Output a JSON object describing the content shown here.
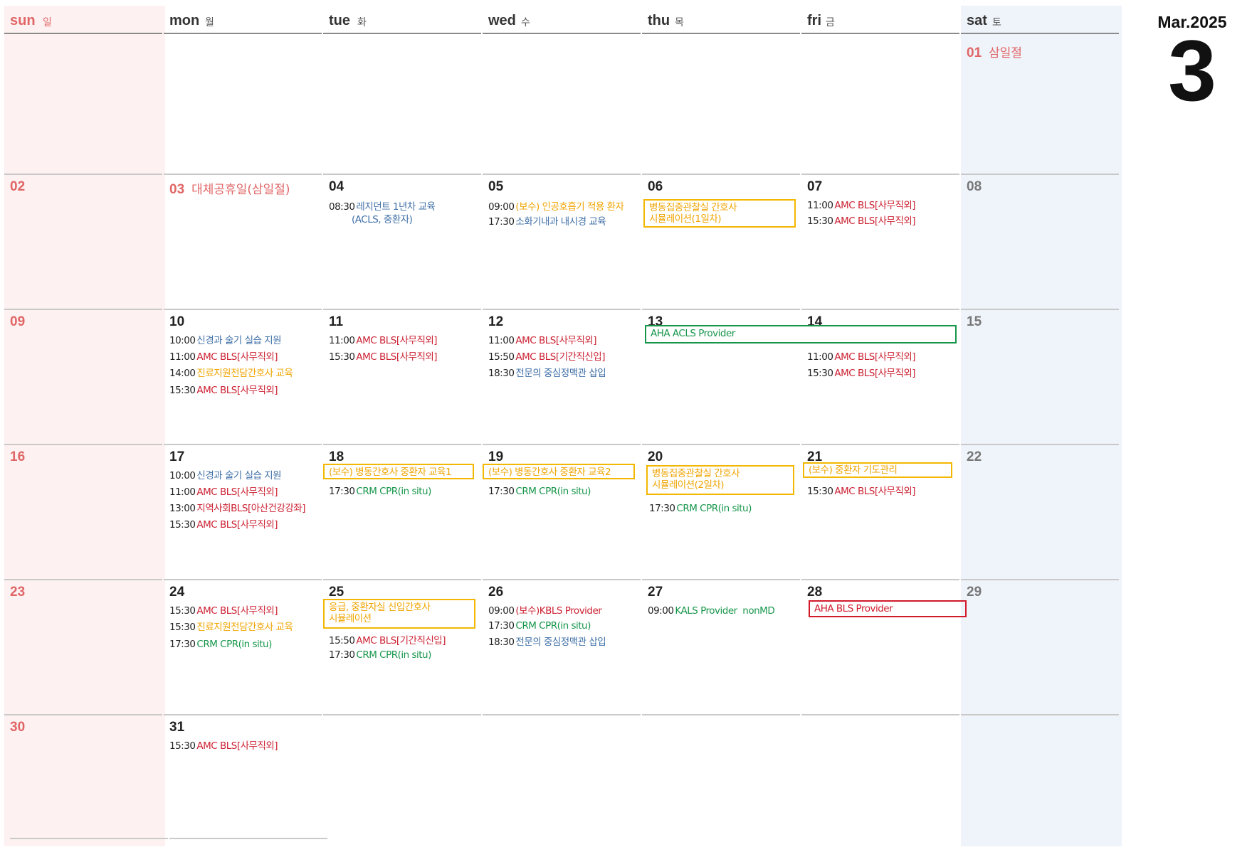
{
  "header": {
    "month_year": "Mar.2025",
    "month_number": "3"
  },
  "weekdays": [
    {
      "en": "sun",
      "ko": "일"
    },
    {
      "en": "mon",
      "ko": "월"
    },
    {
      "en": "tue",
      "ko": "화"
    },
    {
      "en": "wed",
      "ko": "수"
    },
    {
      "en": "thu",
      "ko": "목"
    },
    {
      "en": "fri",
      "ko": "금"
    },
    {
      "en": "sat",
      "ko": "토"
    }
  ],
  "days": {
    "d01": {
      "num": "01",
      "holiday": "삼일절"
    },
    "d02": {
      "num": "02"
    },
    "d03": {
      "num": "03",
      "holiday": "대체공휴일(삼일절)"
    },
    "d04": {
      "num": "04",
      "events": [
        {
          "time": "08:30",
          "title": "레지던트 1년차 교육",
          "title2": "(ACLS, 중환자)"
        }
      ]
    },
    "d05": {
      "num": "05",
      "events": [
        {
          "time": "09:00",
          "title": "(보수) 인공호흡기 적용 환자"
        },
        {
          "time": "17:30",
          "title": "소화기내과 내시경 교육"
        }
      ]
    },
    "d06": {
      "num": "06",
      "box": {
        "line1": "병동집중관찰실 간호사",
        "line2": "시뮬레이션(1일차)"
      }
    },
    "d07": {
      "num": "07",
      "events": [
        {
          "time": "11:00",
          "title": "AMC BLS[사무직외]"
        },
        {
          "time": "15:30",
          "title": "AMC BLS[사무직외]"
        }
      ]
    },
    "d08": {
      "num": "08"
    },
    "d09": {
      "num": "09"
    },
    "d10": {
      "num": "10",
      "events": [
        {
          "time": "10:00",
          "title": "신경과 술기 실습 지원"
        },
        {
          "time": "11:00",
          "title": "AMC BLS[사무직외]"
        },
        {
          "time": "14:00",
          "title": "진료지원전담간호사 교육"
        },
        {
          "time": "15:30",
          "title": "AMC BLS[사무직외]"
        }
      ]
    },
    "d11": {
      "num": "11",
      "events": [
        {
          "time": "11:00",
          "title": "AMC BLS[사무직외]"
        },
        {
          "time": "15:30",
          "title": "AMC BLS[사무직외]"
        }
      ]
    },
    "d12": {
      "num": "12",
      "events": [
        {
          "time": "11:00",
          "title": "AMC BLS[사무직외]"
        },
        {
          "time": "15:50",
          "title": "AMC BLS[기간직신입]"
        },
        {
          "time": "18:30",
          "title": "전문의 중심정맥관 삽입"
        }
      ]
    },
    "d13": {
      "num": "13",
      "span_box": "AHA ACLS Provider"
    },
    "d14": {
      "num": "14",
      "events": [
        {
          "time": "11:00",
          "title": "AMC BLS[사무직외]"
        },
        {
          "time": "15:30",
          "title": "AMC BLS[사무직외]"
        }
      ]
    },
    "d15": {
      "num": "15"
    },
    "d16": {
      "num": "16"
    },
    "d17": {
      "num": "17",
      "events": [
        {
          "time": "10:00",
          "title": "신경과 술기 실습 지원"
        },
        {
          "time": "11:00",
          "title": "AMC BLS[사무직외]"
        },
        {
          "time": "13:00",
          "title": "지역사회BLS[아산건강강좌]"
        },
        {
          "time": "15:30",
          "title": "AMC BLS[사무직외]"
        }
      ]
    },
    "d18": {
      "num": "18",
      "box": {
        "line1": "(보수) 병동간호사 중환자 교육1"
      },
      "events": [
        {
          "time": "17:30",
          "title": "CRM CPR(in situ)"
        }
      ]
    },
    "d19": {
      "num": "19",
      "box": {
        "line1": "(보수) 병동간호사 중환자 교육2"
      },
      "events": [
        {
          "time": "17:30",
          "title": "CRM CPR(in situ)"
        }
      ]
    },
    "d20": {
      "num": "20",
      "box": {
        "line1": "병동집중관찰실 간호사",
        "line2": "시뮬레이션(2일차)"
      },
      "events": [
        {
          "time": "17:30",
          "title": "CRM CPR(in situ)"
        }
      ]
    },
    "d21": {
      "num": "21",
      "box": {
        "line1": "(보수) 중환자 기도관리"
      },
      "events": [
        {
          "time": "15:30",
          "title": "AMC BLS[사무직외]"
        }
      ]
    },
    "d22": {
      "num": "22"
    },
    "d23": {
      "num": "23"
    },
    "d24": {
      "num": "24",
      "events": [
        {
          "time": "15:30",
          "title": "AMC BLS[사무직외]"
        },
        {
          "time": "15:30",
          "title": "진료지원전담간호사 교육"
        },
        {
          "time": "17:30",
          "title": "CRM CPR(in situ)"
        }
      ]
    },
    "d25": {
      "num": "25",
      "box": {
        "line1": "응급, 중환자실 신입간호사",
        "line2": "시뮬레이션"
      },
      "events": [
        {
          "time": "15:50",
          "title": "AMC BLS[기간직신입]"
        },
        {
          "time": "17:30",
          "title": "CRM CPR(in situ)"
        }
      ]
    },
    "d26": {
      "num": "26",
      "events": [
        {
          "time": "09:00",
          "title": "(보수)KBLS Provider"
        },
        {
          "time": "17:30",
          "title": "CRM CPR(in situ)"
        },
        {
          "time": "18:30",
          "title": "전문의 중심정맥관 삽입"
        }
      ]
    },
    "d27": {
      "num": "27",
      "events": [
        {
          "time": "09:00",
          "title": "KALS Provider  nonMD"
        }
      ]
    },
    "d28": {
      "num": "28",
      "box": {
        "line1": "AHA BLS Provider"
      }
    },
    "d29": {
      "num": "29"
    },
    "d30": {
      "num": "30"
    },
    "d31": {
      "num": "31",
      "events": [
        {
          "time": "15:30",
          "title": "AMC BLS[사무직외]"
        }
      ]
    }
  }
}
